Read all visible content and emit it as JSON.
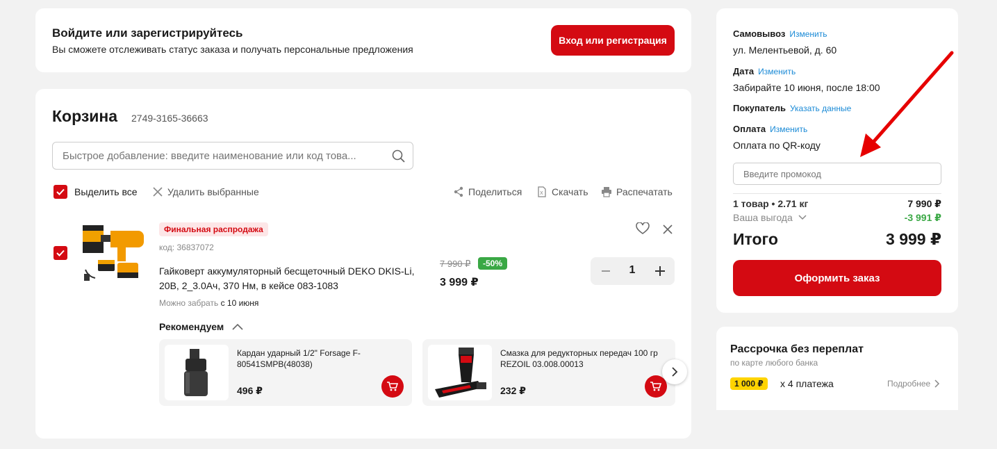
{
  "login": {
    "title": "Войдите или зарегистрируйтесь",
    "subtitle": "Вы сможете отслеживать статус заказа и получать персональные предложения",
    "button": "Вход или регистрация"
  },
  "cart": {
    "title": "Корзина",
    "cart_id": "2749-3165-36663",
    "search_placeholder": "Быстрое добавление: введите наименование или код това...",
    "select_all": "Выделить все",
    "delete_selected": "Удалить выбранные",
    "share": "Поделиться",
    "download": "Скачать",
    "print": "Распечатать"
  },
  "item": {
    "badge": "Финальная распродажа",
    "code": "код: 36837072",
    "name": "Гайковерт аккумуляторный бесщеточный DEKO DKIS-Li, 20В, 2_3.0Ач, 370 Нм, в кейсе 083-1083",
    "pickup_label": "Можно забрать",
    "pickup_date": "с 10 июня",
    "old_price": "7 990 ₽",
    "discount": "-50%",
    "price": "3 999 ₽",
    "quantity": "1"
  },
  "recommend": {
    "title": "Рекомендуем",
    "items": [
      {
        "name": "Кардан ударный 1/2\" Forsage F-80541SMPB(48038)",
        "price": "496 ₽"
      },
      {
        "name": "Смазка для редукторных передач 100 гр REZOIL 03.008.00013",
        "price": "232 ₽"
      }
    ]
  },
  "summary": {
    "pickup_label": "Самовывоз",
    "pickup_change": "Изменить",
    "address": "ул. Мелентьевой, д. 60",
    "date_label": "Дата",
    "date_change": "Изменить",
    "date_value": "Забирайте 10 июня, после 18:00",
    "buyer_label": "Покупатель",
    "buyer_link": "Указать данные",
    "payment_label": "Оплата",
    "payment_change": "Изменить",
    "payment_value": "Оплата по QR-коду",
    "promo_placeholder": "Введите промокод",
    "items_count": "1 товар • 2.71 кг",
    "items_total": "7 990 ₽",
    "benefit_label": "Ваша выгода",
    "benefit_value": "-3 991 ₽",
    "total_label": "Итого",
    "total_value": "3 999 ₽",
    "checkout": "Оформить заказ"
  },
  "installment": {
    "title": "Рассрочка без переплат",
    "subtitle": "по карте любого банка",
    "amount": "1 000 ₽",
    "times": "x 4 платежа",
    "more": "Подробнее"
  },
  "colors": {
    "accent": "#d40a12",
    "link": "#1a8ad6",
    "green": "#3aa845",
    "yellow": "#ffd400"
  }
}
